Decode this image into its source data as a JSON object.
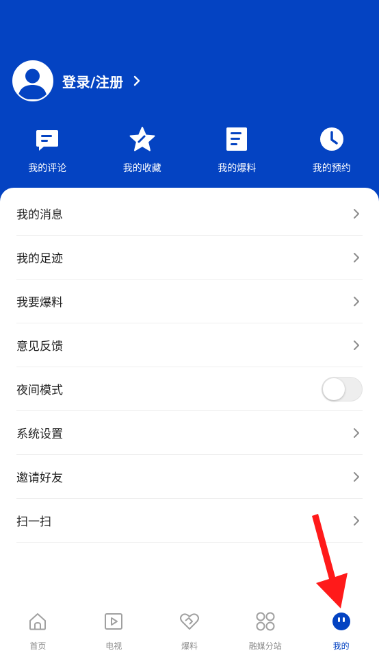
{
  "header": {
    "bg_color": "#0443c2",
    "login_text": "登录/注册"
  },
  "quick_actions": [
    {
      "label": "我的评论",
      "icon": "comment-icon"
    },
    {
      "label": "我的收藏",
      "icon": "star-icon"
    },
    {
      "label": "我的爆料",
      "icon": "document-icon"
    },
    {
      "label": "我的预约",
      "icon": "clock-icon"
    }
  ],
  "menu": [
    {
      "label": "我的消息"
    },
    {
      "label": "我的足迹"
    },
    {
      "label": "我要爆料"
    },
    {
      "label": "意见反馈"
    },
    {
      "label": "夜间模式",
      "toggle": false
    },
    {
      "label": "系统设置"
    },
    {
      "label": "邀请好友"
    },
    {
      "label": "扫一扫"
    }
  ],
  "tabs": [
    {
      "label": "首页",
      "icon": "home-icon",
      "active": false
    },
    {
      "label": "电视",
      "icon": "tv-play-icon",
      "active": false
    },
    {
      "label": "爆料",
      "icon": "heart-icon",
      "active": false
    },
    {
      "label": "融媒分站",
      "icon": "grid-icon",
      "active": false
    },
    {
      "label": "我的",
      "icon": "smiley-icon",
      "active": true
    }
  ],
  "colors": {
    "accent": "#0443c2",
    "annotation_arrow": "#ff1a1a"
  }
}
